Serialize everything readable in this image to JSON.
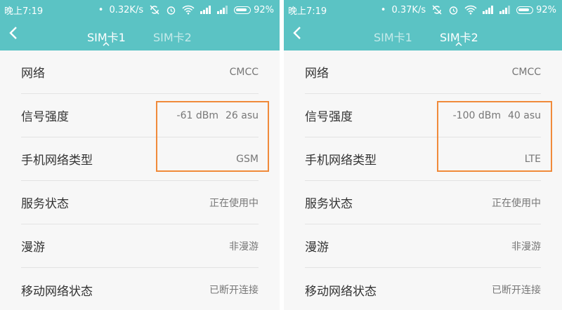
{
  "screens": [
    {
      "status": {
        "time": "晚上7:19",
        "speed": "0.32K/s",
        "battery": "92%"
      },
      "nav": {
        "back": "<",
        "tabs": [
          "SIM卡1",
          "SIM卡2"
        ],
        "active_tab": 0
      },
      "rows": [
        {
          "label": "网络",
          "value": "CMCC"
        },
        {
          "label": "信号强度",
          "value_a": "-61 dBm",
          "value_b": "26 asu"
        },
        {
          "label": "手机网络类型",
          "value": "GSM"
        },
        {
          "label": "服务状态",
          "value": "正在使用中"
        },
        {
          "label": "漫游",
          "value": "非漫游"
        },
        {
          "label": "移动网络状态",
          "value": "已断开连接"
        }
      ]
    },
    {
      "status": {
        "time": "晚上7:19",
        "speed": "0.37K/s",
        "battery": "92%"
      },
      "nav": {
        "back": "<",
        "tabs": [
          "SIM卡1",
          "SIM卡2"
        ],
        "active_tab": 1
      },
      "rows": [
        {
          "label": "网络",
          "value": "CMCC"
        },
        {
          "label": "信号强度",
          "value_a": "-100 dBm",
          "value_b": "40 asu"
        },
        {
          "label": "手机网络类型",
          "value": "LTE"
        },
        {
          "label": "服务状态",
          "value": "正在使用中"
        },
        {
          "label": "漫游",
          "value": "非漫游"
        },
        {
          "label": "移动网络状态",
          "value": "已断开连接"
        }
      ]
    }
  ],
  "colors": {
    "header": "#5bc3c4",
    "highlight": "#f08a3a",
    "background": "#f7f7f7"
  },
  "icons": [
    "no-sync-icon",
    "alarm-icon",
    "wifi-icon",
    "signal-icon",
    "battery-icon",
    "back-arrow-icon"
  ]
}
